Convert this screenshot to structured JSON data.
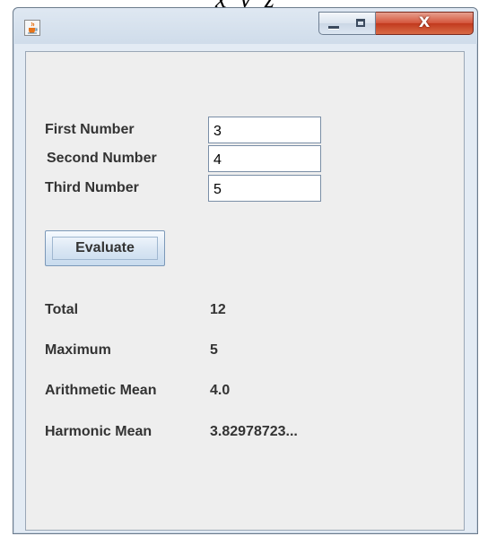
{
  "background": {
    "text": "x y z"
  },
  "window": {
    "close_glyph": "X",
    "icons": {
      "app": "java-cup-icon",
      "minimize": "minimize-icon",
      "maximize": "maximize-icon",
      "close": "close-icon"
    }
  },
  "form": {
    "first": {
      "label": "First Number",
      "value": "3"
    },
    "second": {
      "label": "Second Number",
      "value": "4"
    },
    "third": {
      "label": "Third Number",
      "value": "5"
    },
    "evaluate_label": "Evaluate"
  },
  "results": {
    "total": {
      "label": "Total",
      "value": "12"
    },
    "maximum": {
      "label": "Maximum",
      "value": "5"
    },
    "amean": {
      "label": "Arithmetic Mean",
      "value": "4.0"
    },
    "hmean": {
      "label": "Harmonic Mean",
      "value": "3.82978723..."
    }
  }
}
